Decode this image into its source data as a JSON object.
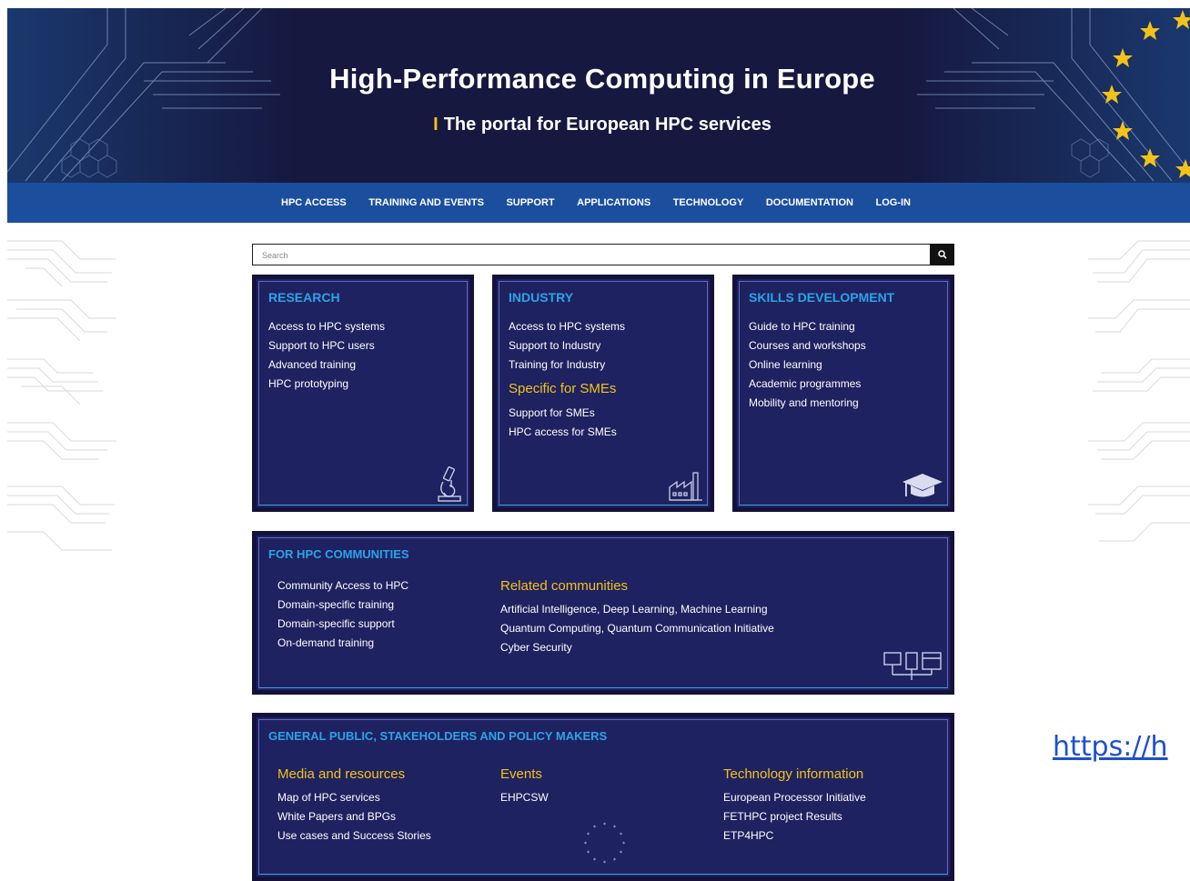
{
  "header": {
    "title": "High-Performance Computing in Europe",
    "subtitle": "The portal for European HPC services",
    "subtitle_mark": "I"
  },
  "nav": {
    "items": [
      {
        "label": "HPC ACCESS"
      },
      {
        "label": "TRAINING AND EVENTS"
      },
      {
        "label": "SUPPORT"
      },
      {
        "label": "APPLICATIONS"
      },
      {
        "label": "TECHNOLOGY"
      },
      {
        "label": "DOCUMENTATION"
      },
      {
        "label": "LOG-IN"
      }
    ]
  },
  "search": {
    "placeholder": "Search",
    "icon": "search-icon"
  },
  "panels": {
    "research": {
      "title": "RESEARCH",
      "items": [
        "Access to HPC systems",
        "Support to HPC users",
        "Advanced training",
        "HPC prototyping"
      ],
      "icon": "microscope-icon"
    },
    "industry": {
      "title": "INDUSTRY",
      "items": [
        "Access to HPC systems",
        "Support to Industry",
        "Training for Industry"
      ],
      "sub_title": "Specific for SMEs",
      "sub_items": [
        "Support for SMEs",
        "HPC access for SMEs"
      ],
      "icon": "factory-icon"
    },
    "skills": {
      "title": "SKILLS DEVELOPMENT",
      "items": [
        "Guide to HPC training",
        "Courses and workshops",
        "Online learning",
        "Academic programmes",
        "Mobility and mentoring"
      ],
      "icon": "graduation-cap-icon"
    },
    "communities": {
      "title": "FOR HPC COMMUNITIES",
      "items": [
        "Community Access to HPC",
        "Domain-specific training",
        "Domain-specific support",
        "On-demand training"
      ],
      "related_title": "Related communities",
      "related_items": [
        "Artificial Intelligence, Deep Learning, Machine Learning",
        "Quantum Computing, Quantum Communication Initiative",
        "Cyber Security"
      ],
      "icon": "network-computers-icon"
    },
    "general": {
      "title": "GENERAL PUBLIC, STAKEHOLDERS AND POLICY MAKERS",
      "media_title": "Media and resources",
      "media_items": [
        "Map of HPC services",
        "White Papers and BPGs",
        "Use cases and Success Stories"
      ],
      "events_title": "Events",
      "events_items": [
        "EHPCSW"
      ],
      "tech_title": "Technology information",
      "tech_items": [
        "European Processor Initiative",
        "FETHPC project Results",
        "ETP4HPC"
      ],
      "icon": "eu-stars-icon"
    }
  },
  "link": {
    "text": "https://h"
  },
  "colors": {
    "banner": "#16183f",
    "nav": "#1c4e9e",
    "panel": "#1f2260",
    "panel_title": "#2aa4e8",
    "accent_yellow": "#f2c21a"
  }
}
